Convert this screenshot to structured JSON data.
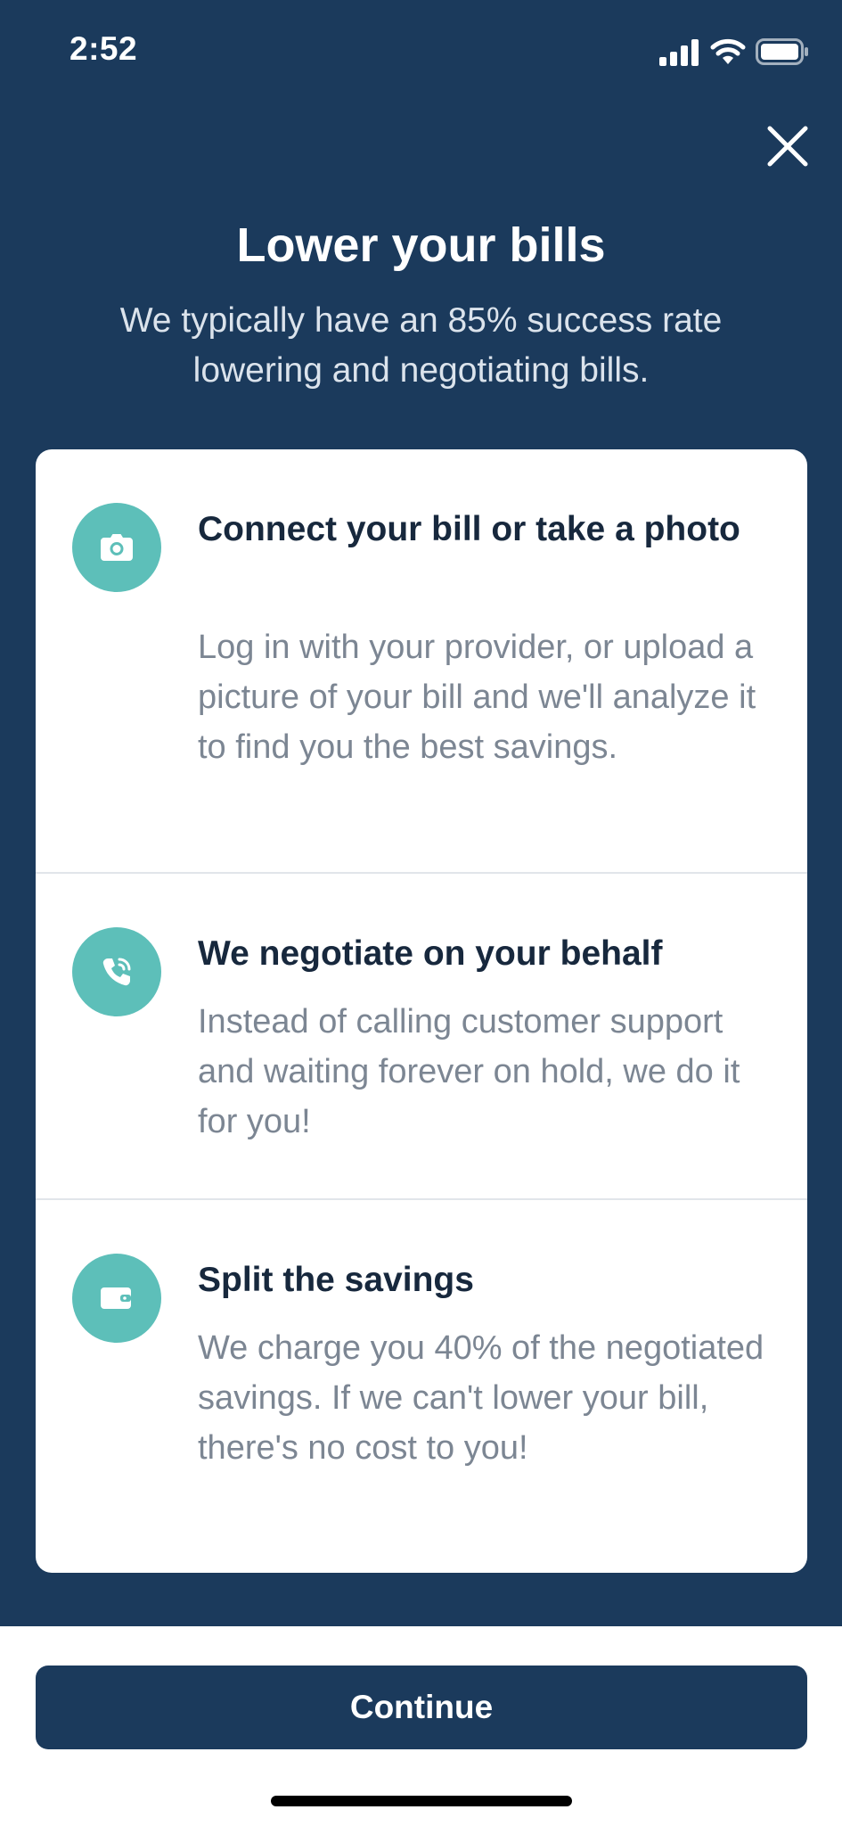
{
  "status_bar": {
    "time": "2:52",
    "icons": [
      "signal-icon",
      "wifi-icon",
      "battery-icon"
    ]
  },
  "header": {
    "close_icon": "close-icon",
    "title": "Lower your bills",
    "subtitle": "We typically have an 85% success rate lowering and negotiating bills."
  },
  "steps": [
    {
      "icon": "camera-icon",
      "title": "Connect your bill or take a photo",
      "description": "Log in with your provider, or upload a picture of your bill and we'll analyze it to find you the best savings."
    },
    {
      "icon": "phone-call-icon",
      "title": "We negotiate on your behalf",
      "description": "Instead of calling customer support and waiting forever on hold, we do it for you!"
    },
    {
      "icon": "wallet-icon",
      "title": "Split the savings",
      "description": "We charge you 40% of the negotiated savings. If we can't lower your bill, there's no cost to you!"
    }
  ],
  "footer": {
    "continue_label": "Continue"
  },
  "colors": {
    "background_navy": "#1b3a5c",
    "accent_teal": "#5dbfb9",
    "title_text": "#17283d",
    "body_text": "#7c8693"
  }
}
